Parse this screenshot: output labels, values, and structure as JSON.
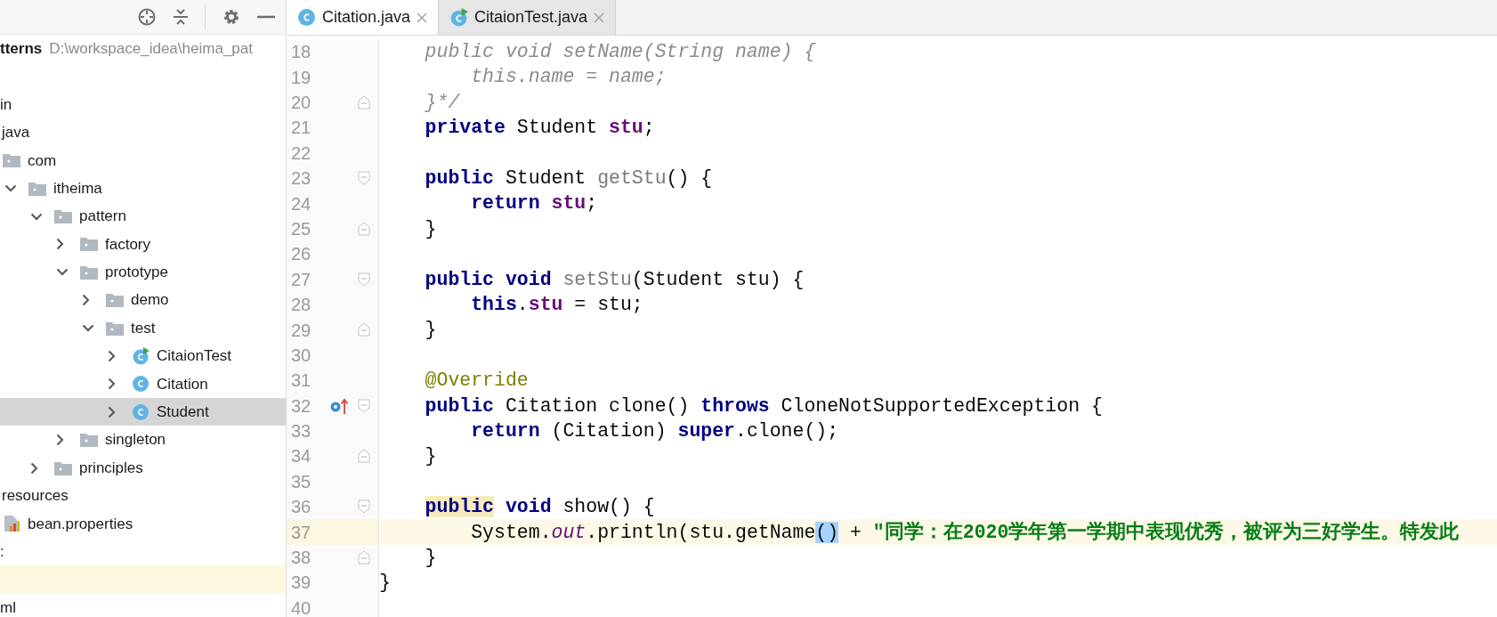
{
  "project_panel": {
    "toolbar": [
      {
        "kind": "locate"
      },
      {
        "kind": "collapse"
      },
      {
        "kind": "settings"
      },
      {
        "kind": "hide"
      }
    ],
    "tree": [
      {
        "kind": "project",
        "label": "tterns",
        "path": "D:\\workspace_idea\\heima_pat",
        "children": [
          {
            "kind": "blank",
            "highlighted": false
          },
          {
            "label": "in",
            "children": [
              {
                "label": "java",
                "children": [
                  {
                    "kind": "folder",
                    "label": "com",
                    "children": [
                      {
                        "kind": "folder",
                        "label": "itheima",
                        "expanded": true,
                        "children": [
                          {
                            "kind": "folder",
                            "label": "pattern",
                            "expanded": true,
                            "children": [
                              {
                                "kind": "folder",
                                "label": "factory",
                                "expanded": false
                              },
                              {
                                "kind": "folder",
                                "label": "prototype",
                                "expanded": true,
                                "children": [
                                  {
                                    "kind": "folder",
                                    "label": "demo",
                                    "expanded": false
                                  },
                                  {
                                    "kind": "folder",
                                    "label": "test",
                                    "expanded": true,
                                    "children": [
                                      {
                                        "kind": "test-class",
                                        "label": "CitaionTest",
                                        "expanded": false,
                                        "selected": false
                                      },
                                      {
                                        "kind": "class",
                                        "label": "Citation",
                                        "expanded": false,
                                        "selected": false
                                      },
                                      {
                                        "kind": "class",
                                        "label": "Student",
                                        "expanded": false,
                                        "selected": true
                                      }
                                    ]
                                  }
                                ]
                              },
                              {
                                "kind": "folder",
                                "label": "singleton",
                                "expanded": false
                              }
                            ]
                          },
                          {
                            "kind": "folder",
                            "label": "principles",
                            "expanded": false
                          }
                        ]
                      }
                    ]
                  }
                ]
              },
              {
                "label": "resources",
                "children": [
                  {
                    "kind": "properties",
                    "label": "bean.properties"
                  }
                ]
              }
            ]
          },
          {
            "label": ":"
          },
          {
            "kind": "blank",
            "highlighted": true
          },
          {
            "label": "ml"
          }
        ]
      }
    ]
  },
  "editor": {
    "tabs": [
      {
        "label": "Citation.java",
        "kind": "class",
        "selected": true
      },
      {
        "label": "CitaionTest.java",
        "kind": "test-class",
        "selected": false
      }
    ],
    "lines": [
      {
        "number": "18",
        "tokens": [
          {
            "kind": "comment",
            "text": "    public void setName(String name) {"
          }
        ]
      },
      {
        "number": "19",
        "tokens": [
          {
            "kind": "comment",
            "text": "        this.name = name;"
          }
        ]
      },
      {
        "number": "20",
        "fold": {
          "kind": "end"
        },
        "tokens": [
          {
            "kind": "comment",
            "text": "    }*/"
          }
        ]
      },
      {
        "number": "21",
        "tokens": [
          {
            "kind": "keyword",
            "text": "    private "
          },
          {
            "kind": "plain",
            "text": "Student "
          },
          {
            "kind": "field",
            "text": "stu"
          },
          {
            "kind": "plain",
            "text": ";"
          }
        ]
      },
      {
        "number": "22"
      },
      {
        "number": "23",
        "fold": {
          "kind": "start"
        },
        "tokens": [
          {
            "kind": "keyword",
            "text": "    public "
          },
          {
            "kind": "plain",
            "text": "Student "
          },
          {
            "kind": "unused",
            "text": "getStu"
          },
          {
            "kind": "plain",
            "text": "() {"
          }
        ]
      },
      {
        "number": "24",
        "tokens": [
          {
            "kind": "keyword",
            "text": "        return "
          },
          {
            "kind": "field",
            "text": "stu"
          },
          {
            "kind": "plain",
            "text": ";"
          }
        ]
      },
      {
        "number": "25",
        "fold": {
          "kind": "end"
        },
        "tokens": [
          {
            "kind": "plain",
            "text": "    }"
          }
        ]
      },
      {
        "number": "26"
      },
      {
        "number": "27",
        "fold": {
          "kind": "start"
        },
        "tokens": [
          {
            "kind": "keyword",
            "text": "    public void "
          },
          {
            "kind": "unused",
            "text": "setStu"
          },
          {
            "kind": "plain",
            "text": "(Student stu) {"
          }
        ]
      },
      {
        "number": "28",
        "tokens": [
          {
            "kind": "keyword",
            "text": "        this"
          },
          {
            "kind": "plain",
            "text": "."
          },
          {
            "kind": "field",
            "text": "stu"
          },
          {
            "kind": "plain",
            "text": " = stu;"
          }
        ]
      },
      {
        "number": "29",
        "fold": {
          "kind": "end"
        },
        "tokens": [
          {
            "kind": "plain",
            "text": "    }"
          }
        ]
      },
      {
        "number": "30"
      },
      {
        "number": "31",
        "tokens": [
          {
            "kind": "annotation",
            "text": "    @Override"
          }
        ]
      },
      {
        "number": "32",
        "fold": {
          "kind": "start"
        },
        "gutter_icon": {
          "kind": "override"
        },
        "tokens": [
          {
            "kind": "keyword",
            "text": "    public "
          },
          {
            "kind": "plain",
            "text": "Citation clone() "
          },
          {
            "kind": "keyword",
            "text": "throws "
          },
          {
            "kind": "plain",
            "text": "CloneNotSupportedException {"
          }
        ]
      },
      {
        "number": "33",
        "tokens": [
          {
            "kind": "keyword",
            "text": "        return "
          },
          {
            "kind": "plain",
            "text": "(Citation) "
          },
          {
            "kind": "keyword",
            "text": "super"
          },
          {
            "kind": "plain",
            "text": ".clone();"
          }
        ]
      },
      {
        "number": "34",
        "fold": {
          "kind": "end"
        },
        "tokens": [
          {
            "kind": "plain",
            "text": "    }"
          }
        ]
      },
      {
        "number": "35"
      },
      {
        "number": "36",
        "fold": {
          "kind": "start"
        },
        "tokens": [
          {
            "kind": "marked-keyword",
            "text": "    public"
          },
          {
            "kind": "keyword",
            "text": " void "
          },
          {
            "kind": "plain",
            "text": "show() {"
          }
        ]
      },
      {
        "number": "37",
        "current": true,
        "tokens": [
          {
            "kind": "plain",
            "text": "        System."
          },
          {
            "kind": "static",
            "text": "out"
          },
          {
            "kind": "plain",
            "text": ".println(stu.getName"
          },
          {
            "kind": "selection",
            "text": "()"
          },
          {
            "kind": "plain",
            "text": " + "
          },
          {
            "kind": "string",
            "text": "\"同学：在2020学年第一学期中表现优秀，被评为三好学生。特发此"
          }
        ]
      },
      {
        "number": "38",
        "fold": {
          "kind": "end"
        },
        "tokens": [
          {
            "kind": "plain",
            "text": "    }"
          }
        ]
      },
      {
        "number": "39",
        "tokens": [
          {
            "kind": "plain",
            "text": "}"
          }
        ]
      },
      {
        "number": "40"
      }
    ]
  }
}
